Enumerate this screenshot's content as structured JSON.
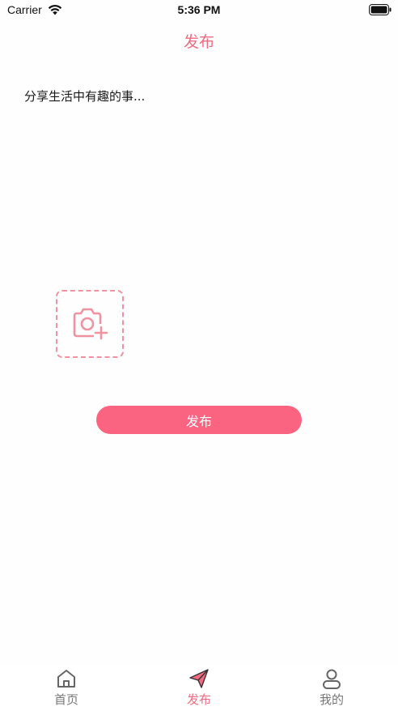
{
  "status_bar": {
    "carrier": "Carrier",
    "time": "5:36 PM"
  },
  "nav": {
    "title": "发布"
  },
  "compose": {
    "placeholder": "分享生活中有趣的事...",
    "value": ""
  },
  "actions": {
    "publish_label": "发布"
  },
  "tabs": [
    {
      "label": "首页",
      "icon": "home-icon",
      "active": false
    },
    {
      "label": "发布",
      "icon": "paper-plane-icon",
      "active": true
    },
    {
      "label": "我的",
      "icon": "user-icon",
      "active": false
    }
  ],
  "colors": {
    "accent": "#ef6b80",
    "button": "#fa6480",
    "dashed_border": "#f0929f",
    "tab_inactive": "#777777"
  }
}
